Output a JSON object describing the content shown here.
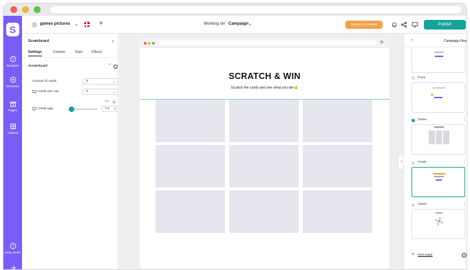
{
  "app": {
    "project_name": "games pictures",
    "working_on_label": "Working on",
    "breadcrumb_sep": "/",
    "campaign_label": "Campaign",
    "status_label": "Behind on website",
    "publish_label": "Publish",
    "logo_glyph": "S"
  },
  "rail": {
    "items": [
      {
        "label": "Designer",
        "icon": "palette-icon"
      },
      {
        "label": "Elements",
        "icon": "plus-circle-icon"
      },
      {
        "label": "Pages",
        "icon": "gift-icon"
      },
      {
        "label": "Addons",
        "icon": "grid-icon"
      }
    ],
    "help_label": "Help center"
  },
  "panel": {
    "title": "Scratchcard",
    "tabs": [
      "Settings",
      "Content",
      "Style",
      "Effects"
    ],
    "active_tab": "Settings",
    "section_title": "Scratchcard",
    "rows": [
      {
        "label": "Amount of cards",
        "value": "9"
      },
      {
        "label": "Cards per row",
        "value": "3"
      },
      {
        "label": "Cards gap",
        "value": "7.5"
      }
    ],
    "units": [
      "rem",
      "px"
    ],
    "gap_fraction": 0.1
  },
  "preview": {
    "title": "SCRATCH & WIN",
    "subtitle": "Scratch the cards and see what you win✌️",
    "cards": 9
  },
  "flow": {
    "title": "Campaign flow",
    "steps": [
      {
        "label": "Form"
      },
      {
        "label": "Game"
      },
      {
        "label": "Finish"
      },
      {
        "label": "Game"
      }
    ],
    "new_page_label": "New page"
  },
  "colors": {
    "accent": "#7b5cf6",
    "teal": "#16a49a",
    "status": "#f3a24a",
    "card": "#e6e6ee"
  }
}
